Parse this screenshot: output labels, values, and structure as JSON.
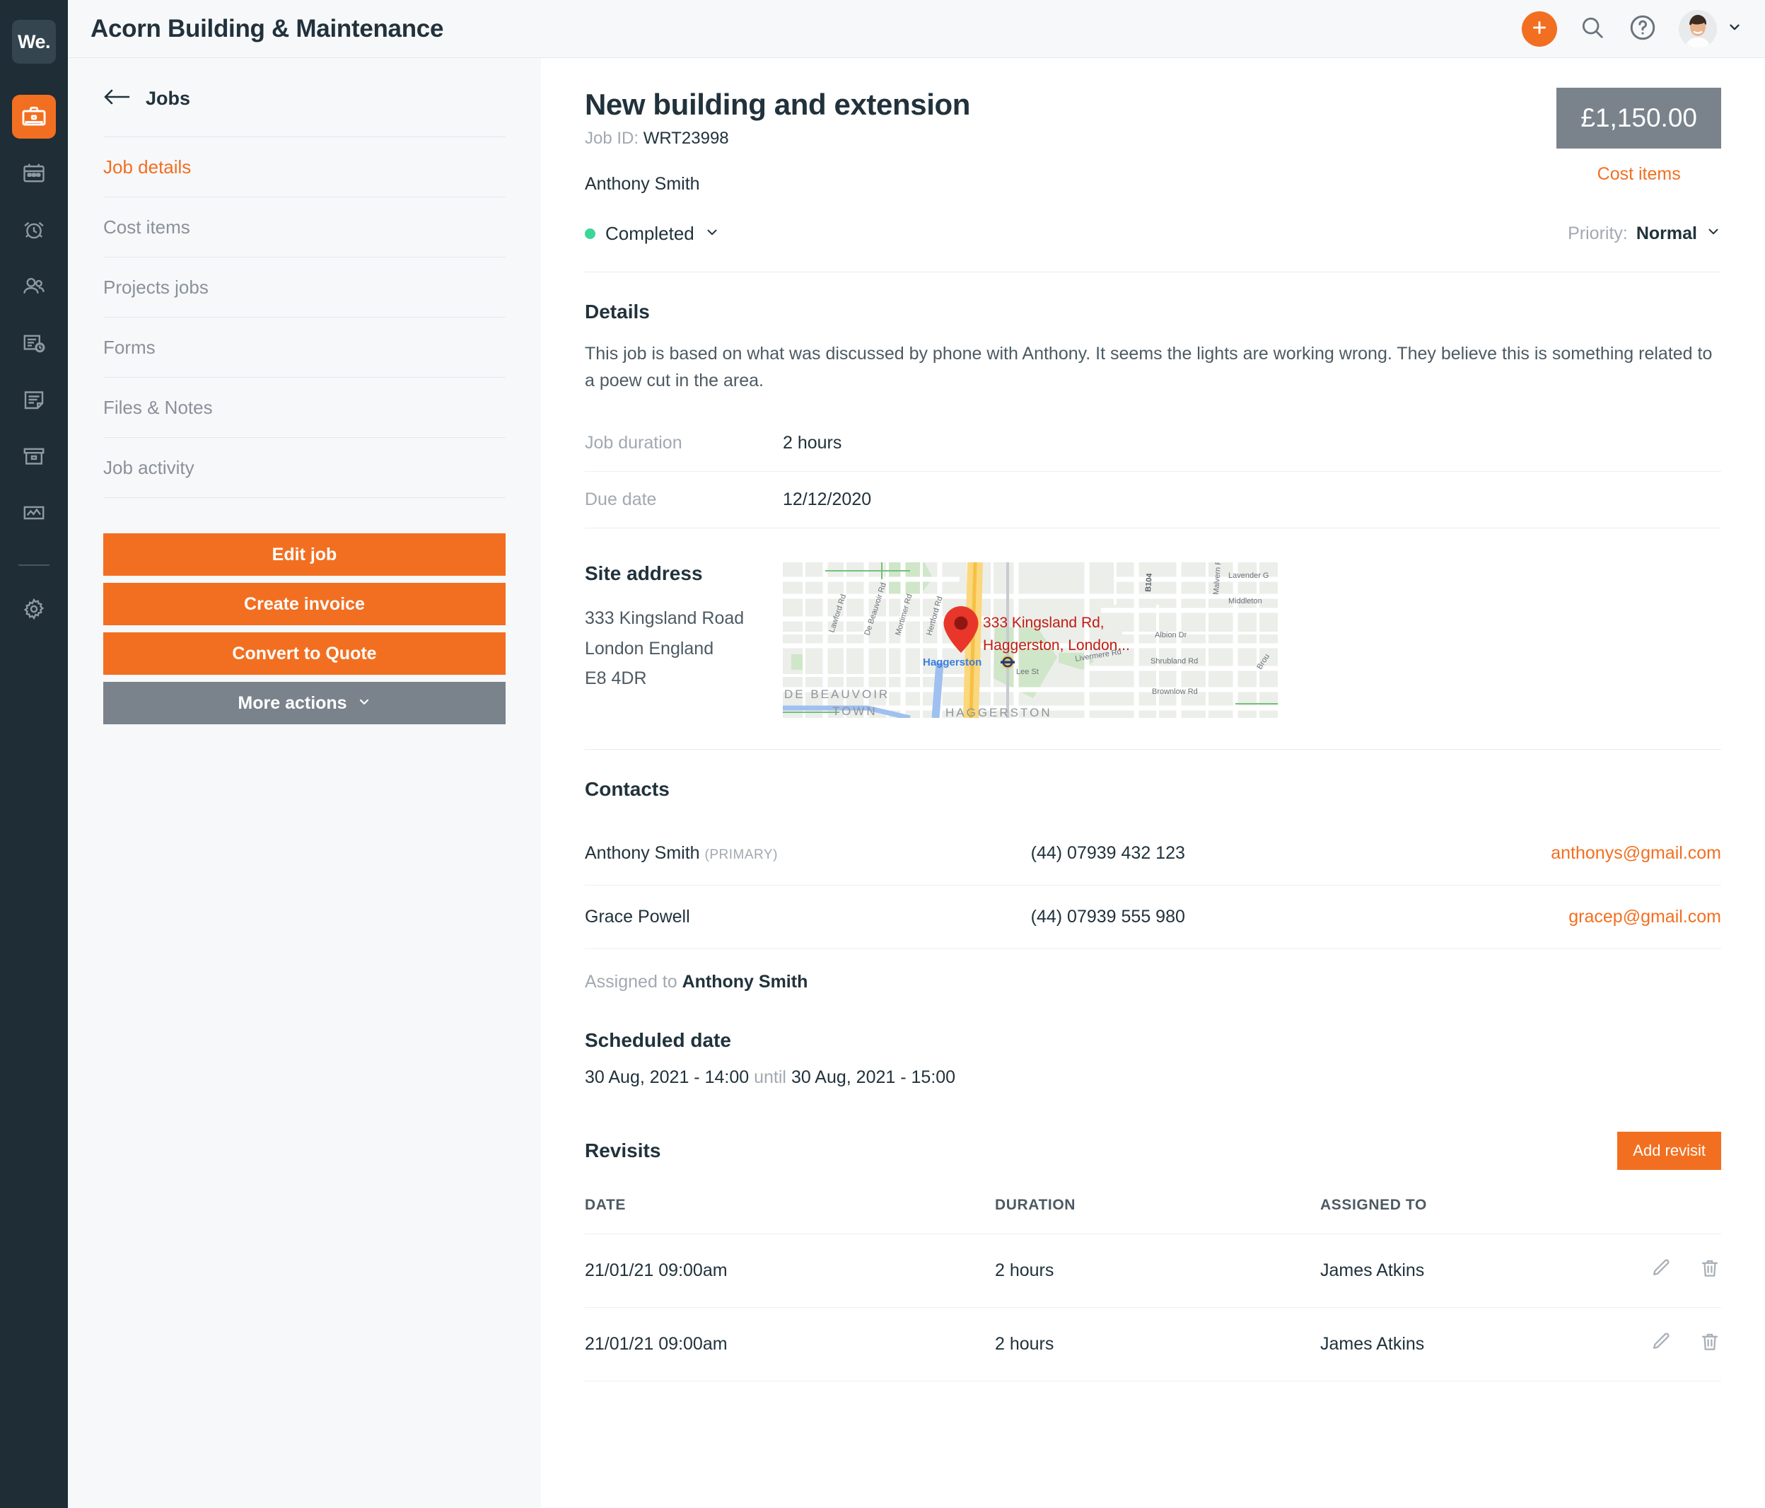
{
  "brand": {
    "logo_text": "We.",
    "accent": "#f26f21",
    "rail_bg": "#1e2d36"
  },
  "rail": {
    "items": [
      {
        "name": "jobs",
        "icon": "briefcase-icon",
        "active": true
      },
      {
        "name": "calendar",
        "icon": "calendar-icon",
        "active": false
      },
      {
        "name": "timesheets",
        "icon": "alarm-clock-icon",
        "active": false
      },
      {
        "name": "customers",
        "icon": "people-icon",
        "active": false
      },
      {
        "name": "quotes",
        "icon": "document-clock-icon",
        "active": false
      },
      {
        "name": "invoices",
        "icon": "document-icon",
        "active": false
      },
      {
        "name": "inventory",
        "icon": "archive-box-icon",
        "active": false
      },
      {
        "name": "reports",
        "icon": "chart-line-icon",
        "active": false
      },
      {
        "name": "settings",
        "icon": "gear-icon",
        "active": false
      }
    ]
  },
  "header": {
    "title": "Acorn Building & Maintenance",
    "add_label": "+",
    "icons": {
      "add": "plus-icon",
      "search": "search-icon",
      "help": "help-circle-icon",
      "chevron": "chevron-down-icon"
    }
  },
  "leftpanel": {
    "back_label": "Jobs",
    "nav": [
      {
        "label": "Job details",
        "active": true
      },
      {
        "label": "Cost items",
        "active": false
      },
      {
        "label": "Projects jobs",
        "active": false
      },
      {
        "label": "Forms",
        "active": false
      },
      {
        "label": "Files & Notes",
        "active": false
      },
      {
        "label": "Job activity",
        "active": false
      }
    ],
    "buttons": [
      {
        "label": "Edit job",
        "style": "primary"
      },
      {
        "label": "Create invoice",
        "style": "primary"
      },
      {
        "label": "Convert to Quote",
        "style": "primary"
      },
      {
        "label": "More actions",
        "style": "grey",
        "caret": true
      }
    ]
  },
  "job": {
    "title": "New building and extension",
    "id_label": "Job ID:",
    "id_value": "WRT23998",
    "client": "Anthony Smith",
    "status": "Completed",
    "status_color": "#3dd598",
    "priority_label": "Priority:",
    "priority_value": "Normal",
    "price": "£1,150.00",
    "cost_items_link": "Cost items"
  },
  "details": {
    "heading": "Details",
    "body": "This job is based on what was discussed by phone with Anthony. It seems the lights are working wrong. They believe this is something related to a poew cut in the area.",
    "rows": [
      {
        "key": "Job duration",
        "value": "2 hours"
      },
      {
        "key": "Due date",
        "value": "12/12/2020"
      }
    ]
  },
  "site_address": {
    "heading": "Site address",
    "lines": [
      "333 Kingsland Road",
      "London England",
      "E8 4DR"
    ],
    "map": {
      "pin_label_line1": "333 Kingsland Rd,",
      "pin_label_line2": "Haggerston, London...",
      "station": "Haggerston",
      "area_labels": [
        "DE BEAUVOIR",
        "TOWN",
        "HAGGERSTON"
      ],
      "street_labels": [
        "Lawford Rd",
        "De Beauvoir Rd",
        "Mortimer Rd",
        "Hertford Rd",
        "B104",
        "Malvern R",
        "Lavender G",
        "Middleton",
        "Albion Dr",
        "Livermere Rd",
        "Shrubland Rd",
        "Brownlow Rd",
        "Lee St",
        "Brou"
      ]
    }
  },
  "contacts": {
    "heading": "Contacts",
    "rows": [
      {
        "name": "Anthony Smith",
        "tag": "(PRIMARY)",
        "phone": "(44) 07939 432 123",
        "email": "anthonys@gmail.com"
      },
      {
        "name": "Grace Powell",
        "tag": "",
        "phone": "(44) 07939 555 980",
        "email": "gracep@gmail.com"
      }
    ],
    "assigned_label": "Assigned to",
    "assigned_value": "Anthony Smith"
  },
  "scheduled": {
    "heading": "Scheduled date",
    "start": "30 Aug, 2021 - 14:00",
    "until_label": "until",
    "end": "30 Aug, 2021 - 15:00"
  },
  "revisits": {
    "heading": "Revisits",
    "add_label": "Add revisit",
    "columns": [
      "DATE",
      "DURATION",
      "ASSIGNED TO"
    ],
    "rows": [
      {
        "date": "21/01/21 09:00am",
        "duration": "2 hours",
        "assigned": "James Atkins"
      },
      {
        "date": "21/01/21 09:00am",
        "duration": "2 hours",
        "assigned": "James Atkins"
      }
    ],
    "row_icons": {
      "edit": "pencil-icon",
      "delete": "trash-icon"
    }
  }
}
